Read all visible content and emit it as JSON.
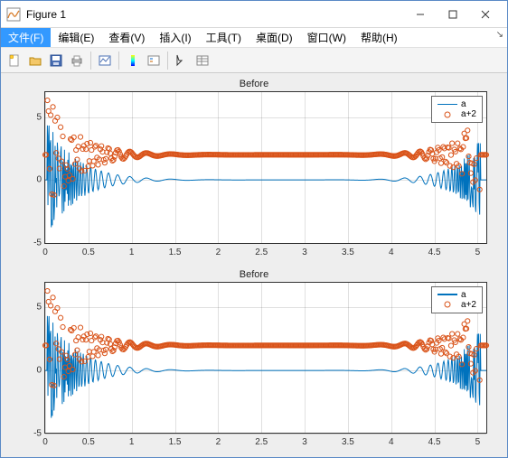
{
  "window": {
    "title": "Figure 1"
  },
  "menu": {
    "file": "文件(F)",
    "edit": "编辑(E)",
    "view": "查看(V)",
    "insert": "插入(I)",
    "tools": "工具(T)",
    "desktop": "桌面(D)",
    "window": "窗口(W)",
    "help": "帮助(H)"
  },
  "chart_data": [
    {
      "type": "line",
      "title": "Before",
      "xlabel": "",
      "ylabel": "",
      "xlim": [
        0,
        5.1
      ],
      "ylim": [
        -5,
        7
      ],
      "xticks": [
        0,
        0.5,
        1,
        1.5,
        2,
        2.5,
        3,
        3.5,
        4,
        4.5,
        5
      ],
      "yticks": [
        -5,
        0,
        5
      ],
      "grid": true,
      "legend": {
        "position": "upper-right",
        "entries": [
          "a",
          "a+2"
        ]
      },
      "series": [
        {
          "name": "a",
          "style": "line",
          "color": "#0072bd",
          "expr": "sinc-like decaying oscillation around x≈0 and x≈5, ~0 in middle",
          "sample_values_at_xticks": [
            null,
            -1.5,
            0.2,
            0.05,
            0,
            0,
            0,
            0,
            0.05,
            -0.3,
            -2.0
          ]
        },
        {
          "name": "a+2",
          "style": "markers",
          "marker": "o",
          "color": "#d95319",
          "expr": "series 'a' shifted up by 2",
          "sample_values_at_xticks": [
            null,
            0.5,
            2.2,
            2.05,
            2,
            2,
            2,
            2,
            2.05,
            1.7,
            0.0
          ]
        }
      ]
    },
    {
      "type": "line",
      "title": "Before",
      "xlabel": "",
      "ylabel": "",
      "xlim": [
        0,
        5.1
      ],
      "ylim": [
        -5,
        7
      ],
      "xticks": [
        0,
        0.5,
        1,
        1.5,
        2,
        2.5,
        3,
        3.5,
        4,
        4.5,
        5
      ],
      "yticks": [
        -5,
        0,
        5
      ],
      "grid": true,
      "legend": {
        "position": "upper-right",
        "entries": [
          "a",
          "a+2"
        ]
      },
      "series": [
        {
          "name": "a",
          "style": "line",
          "color": "#0072bd",
          "expr": "identical to subplot 1",
          "sample_values_at_xticks": [
            null,
            -1.5,
            0.2,
            0.05,
            0,
            0,
            0,
            0,
            0.05,
            -0.3,
            -2.0
          ]
        },
        {
          "name": "a+2",
          "style": "markers",
          "marker": "o",
          "color": "#d95319",
          "expr": "identical to subplot 1",
          "sample_values_at_xticks": [
            null,
            0.5,
            2.2,
            2.05,
            2,
            2,
            2,
            2,
            2.05,
            1.7,
            0.0
          ]
        }
      ]
    }
  ],
  "colors": {
    "series_a": "#0072bd",
    "series_b": "#d95319",
    "bg": "#eeeeee"
  }
}
